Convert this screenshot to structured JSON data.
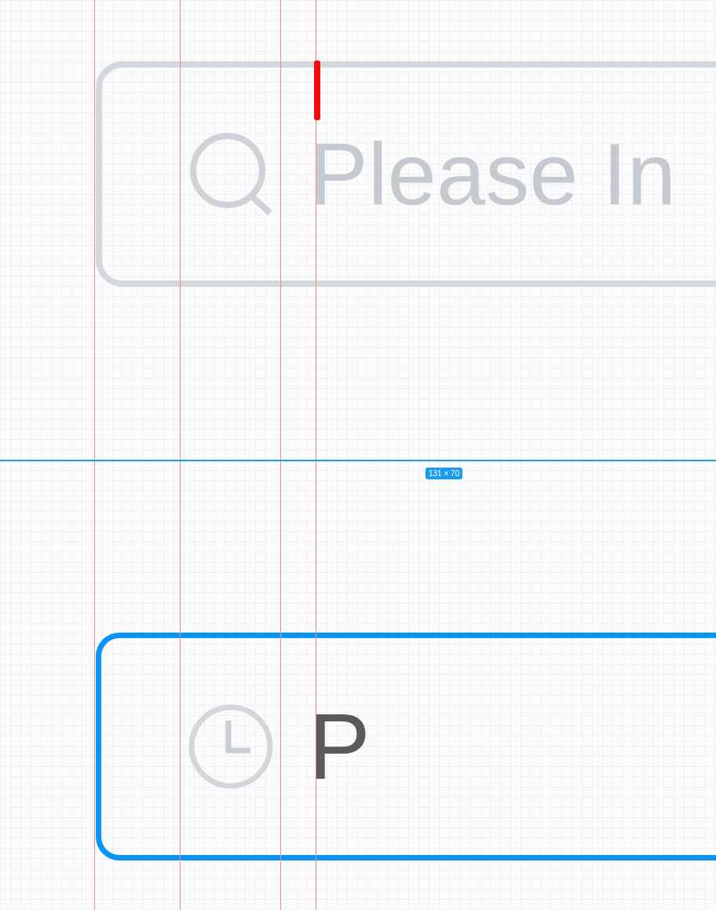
{
  "search_field": {
    "placeholder": "Please In"
  },
  "measurement": {
    "label": "131 × 70"
  },
  "time_field": {
    "value": "P",
    "focused": true
  }
}
